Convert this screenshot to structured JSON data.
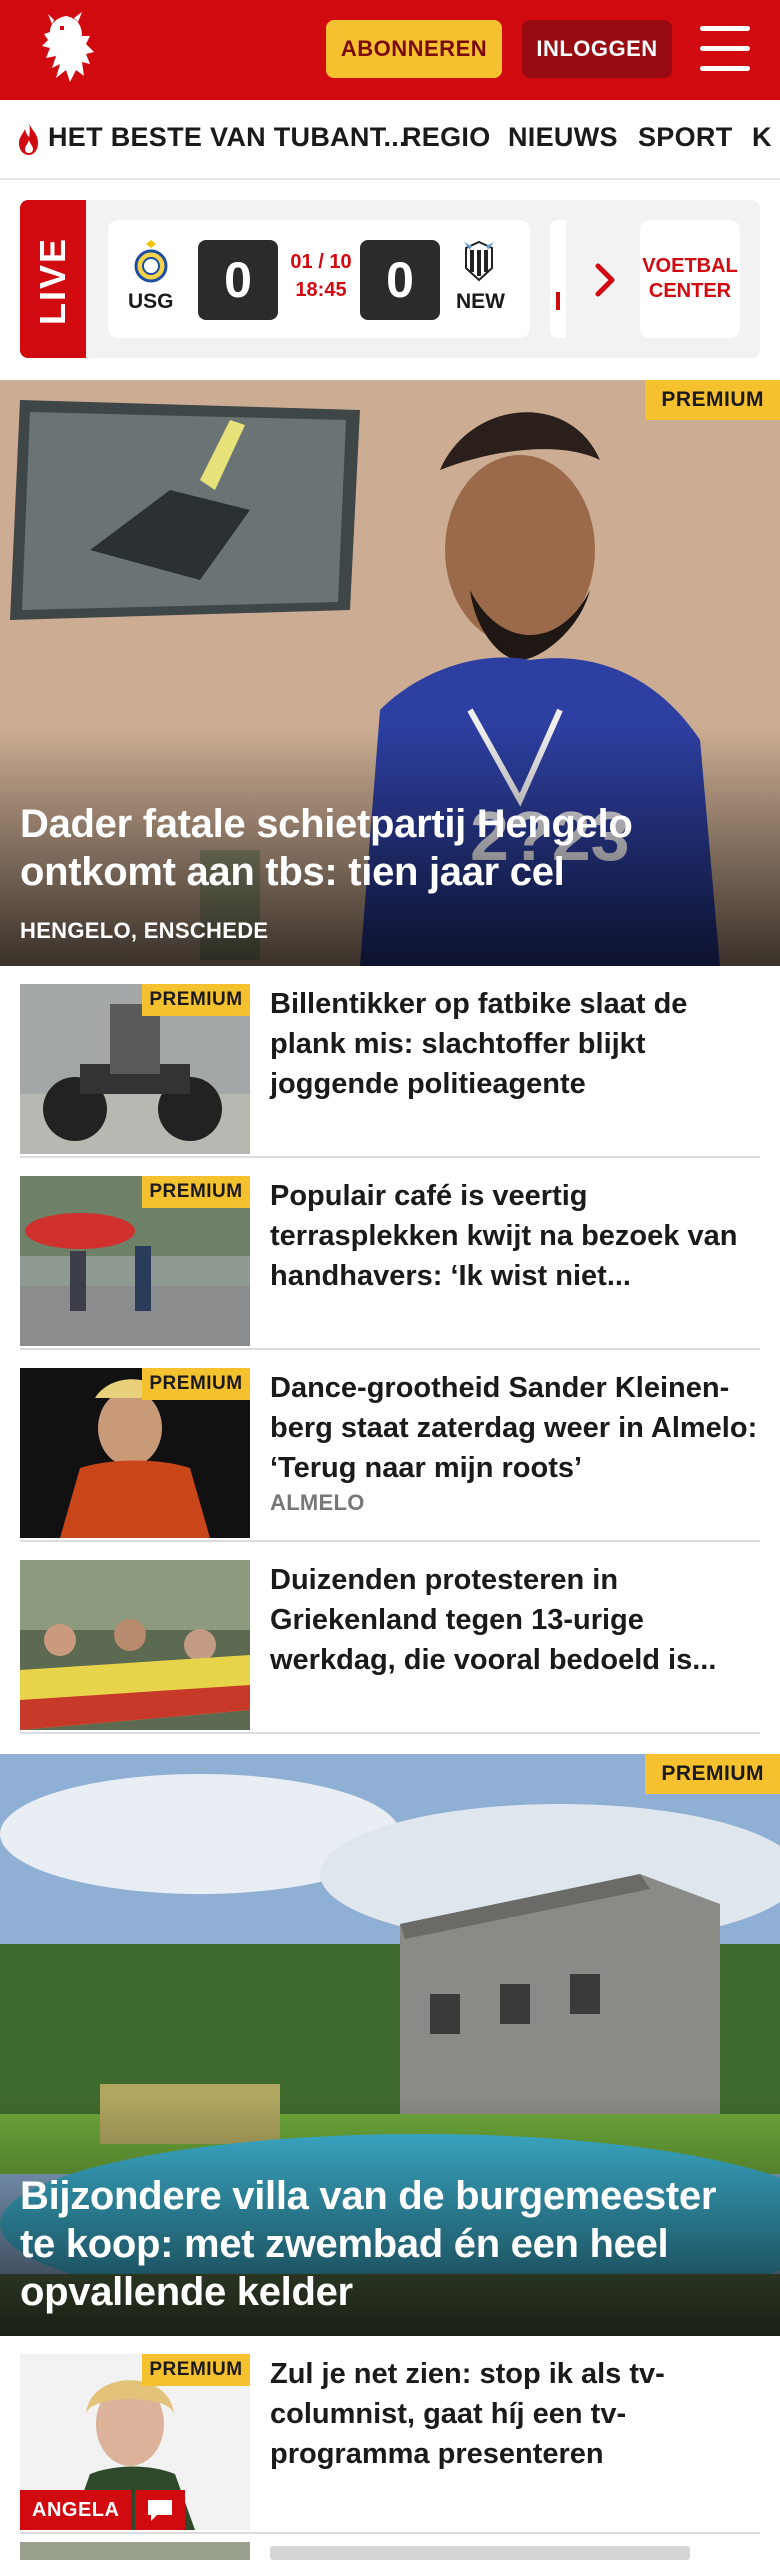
{
  "header": {
    "logo_icon": "tubantia-horse-logo",
    "subscribe_label": "ABONNEREN",
    "login_label": "INLOGGEN",
    "menu_icon": "hamburger-menu-icon",
    "brand_color": "#d10a10"
  },
  "nav": {
    "items": [
      {
        "label": "HET BESTE VAN TUBANT..."
      },
      {
        "label": "REGIO"
      },
      {
        "label": "NIEUWS"
      },
      {
        "label": "SPORT"
      },
      {
        "label": "K"
      }
    ]
  },
  "live": {
    "label": "LIVE",
    "match": {
      "home": "USG",
      "away": "NEW",
      "home_score": "0",
      "away_score": "0",
      "date": "01 / 10",
      "time": "18:45"
    },
    "voetbal_center_line1": "VOETBAL",
    "voetbal_center_line2": "CENTER"
  },
  "hero1": {
    "badge": "PREMIUM",
    "title": "Dader fatale schietpartij Hengelo ontkomt aan tbs: tien jaar cel",
    "location": "HENGELO, ENSCHEDE"
  },
  "articles": [
    {
      "badge": "PREMIUM",
      "title": "Billentikker op fatbike slaat de plank mis: slachtoffer blijkt joggende politieagente",
      "location": ""
    },
    {
      "badge": "PREMIUM",
      "title": "Populair café is veertig terrasplekken kwijt na bezoek van handhavers: ‘Ik wist niet...",
      "location": ""
    },
    {
      "badge": "PREMIUM",
      "title": "Dance-grootheid Sander Kleinen-berg staat zaterdag weer in Almelo: ‘Terug naar mijn roots’",
      "location": "ALMELO"
    },
    {
      "badge": "",
      "title": "Duizenden protesteren in Griekenland tegen 13-urige werkdag, die vooral bedoeld is...",
      "location": ""
    }
  ],
  "hero2": {
    "badge": "PREMIUM",
    "title": "Bijzondere villa van de burgemeester te koop: met zwembad én een heel opvallende kelder"
  },
  "article5": {
    "badge": "PREMIUM",
    "title": "Zul je net zien: stop ik als tv-columnist, gaat híj een tv-programma presenteren",
    "author": "ANGELA"
  }
}
